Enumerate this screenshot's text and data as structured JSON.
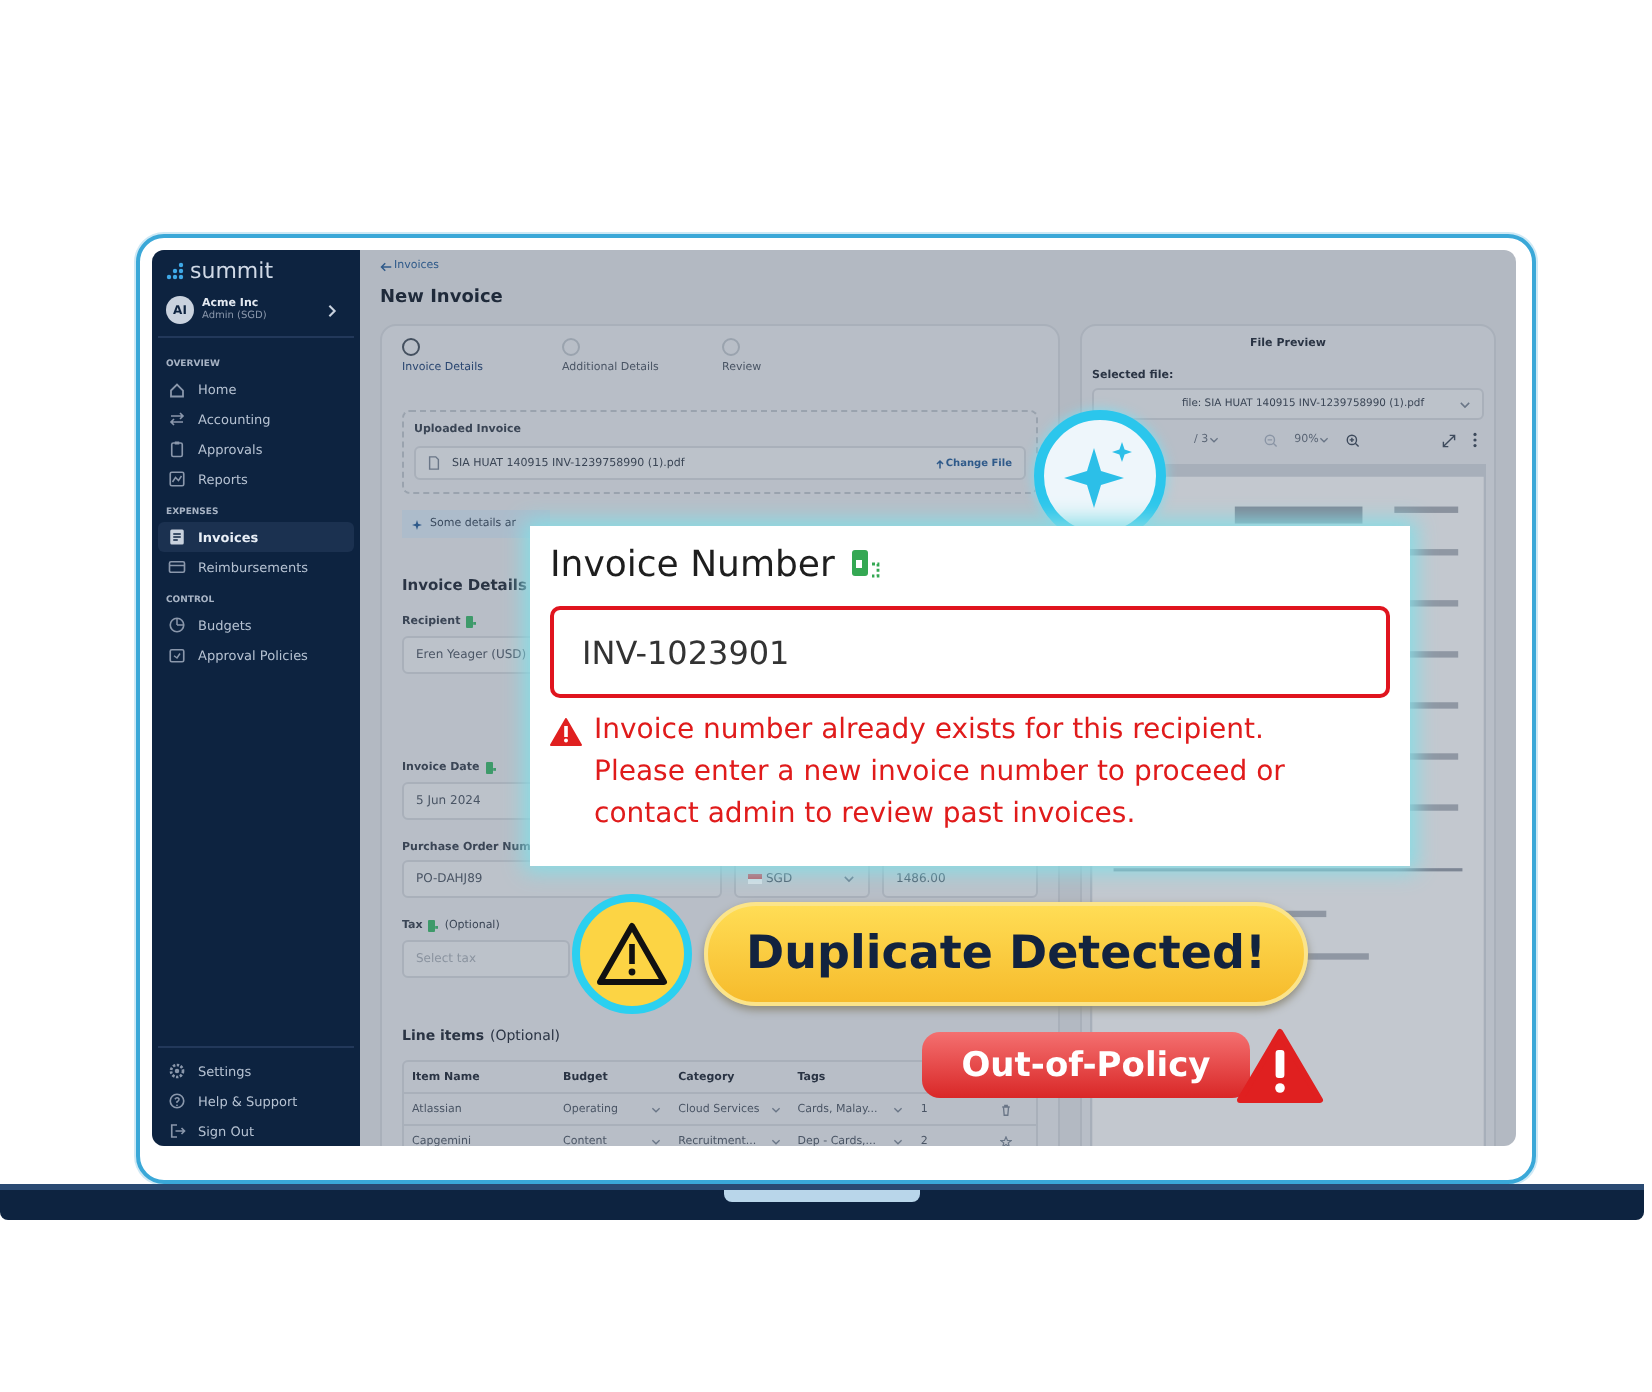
{
  "app": {
    "logo": "summit",
    "account": {
      "initials": "AI",
      "name": "Acme Inc",
      "role": "Admin (SGD)"
    }
  },
  "sidebar": {
    "sections": [
      {
        "title": "OVERVIEW",
        "items": [
          {
            "label": "Home",
            "kind": "home",
            "selected": false
          },
          {
            "label": "Accounting",
            "kind": "arrows",
            "selected": false
          },
          {
            "label": "Approvals",
            "kind": "clipboard",
            "selected": false
          },
          {
            "label": "Reports",
            "kind": "chart",
            "selected": false
          }
        ]
      },
      {
        "title": "EXPENSES",
        "items": [
          {
            "label": "Invoices",
            "kind": "document",
            "selected": true
          },
          {
            "label": "Reimbursements",
            "kind": "card",
            "selected": false
          }
        ]
      },
      {
        "title": "CONTROL",
        "items": [
          {
            "label": "Budgets",
            "kind": "pie",
            "selected": false
          },
          {
            "label": "Approval Policies",
            "kind": "folder",
            "selected": false
          }
        ]
      }
    ],
    "footer": [
      {
        "label": "Settings",
        "kind": "gear",
        "selected": false
      },
      {
        "label": "Help & Support",
        "kind": "help",
        "selected": false
      },
      {
        "label": "Sign Out",
        "kind": "signout",
        "selected": false
      }
    ]
  },
  "breadcrumb": "Invoices",
  "page_title": "New Invoice",
  "steps": [
    {
      "label": "Invoice Details",
      "selected": true
    },
    {
      "label": "Additional Details",
      "selected": false
    },
    {
      "label": "Review",
      "selected": false
    }
  ],
  "upload": {
    "title": "Uploaded Invoice",
    "file": "SIA HUAT 140915 INV-1239758990  (1).pdf",
    "action": "Change File"
  },
  "banner": "Some details ar",
  "details": {
    "title": "Invoice Details",
    "recipient_label": "Recipient",
    "recipient": "Eren Yeager (USD)",
    "date_label": "Invoice Date",
    "date": "5 Jun 2024",
    "po_label": "Purchase Order Num",
    "po": "PO-DAHJ89",
    "currency": "SGD",
    "amount": "1486.00",
    "tax_label": "Tax",
    "tax_optional": "(Optional)",
    "tax_placeholder": "Select tax"
  },
  "line_items": {
    "title": "Line items",
    "optional": "(Optional)",
    "columns": [
      "Item Name",
      "Budget",
      "Category",
      "Tags"
    ],
    "rows": [
      [
        "Atlassian",
        "Operating",
        "Cloud Services",
        "Cards, Malay...",
        "1"
      ],
      [
        "Capgemini",
        "Content",
        "Recruitment...",
        "Dep - Cards,...",
        "2"
      ]
    ]
  },
  "file_preview": {
    "title": "File Preview",
    "selected_label": "Selected file:",
    "file": "file: SIA HUAT 140915 INV-1239758990  (1).pdf",
    "pages": "/ 3",
    "zoom": "90%"
  },
  "popup": {
    "label": "Invoice Number",
    "value": "INV-1023901",
    "error": "Invoice number already exists for this recipient. Please enter a new invoice number to proceed or contact admin to review past invoices."
  },
  "badges": [
    {
      "kind": "duplicate",
      "label": "Duplicate Detected!"
    },
    {
      "kind": "policy",
      "label": "Out-of-Policy"
    }
  ]
}
